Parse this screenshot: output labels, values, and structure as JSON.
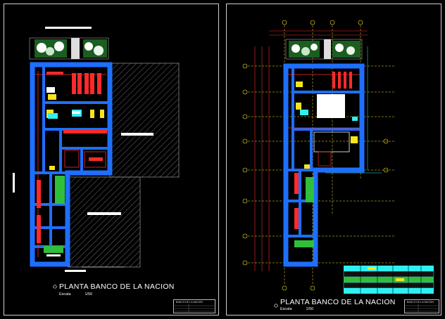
{
  "sheets": [
    {
      "title": "PLANTA BANCO DE LA NACION",
      "scale_label": "Escala",
      "scale_value": "1/50",
      "title_block_text": "BANCO DE LA NACION"
    },
    {
      "title": "PLANTA BANCO DE LA NACION",
      "scale_label": "Escala",
      "scale_value": "1/50",
      "title_block_text": "BANCO DE LA NACION"
    }
  ],
  "colors": {
    "background": "#000000",
    "wall_fill": "#1e6fff",
    "red_lines": "#ff2a2a",
    "yellow": "#f7e51c",
    "green": "#2fbf3a",
    "cyan": "#2ff0f0",
    "gray_hatch": "#7a7a7a",
    "frame": "#cfcfcf"
  }
}
